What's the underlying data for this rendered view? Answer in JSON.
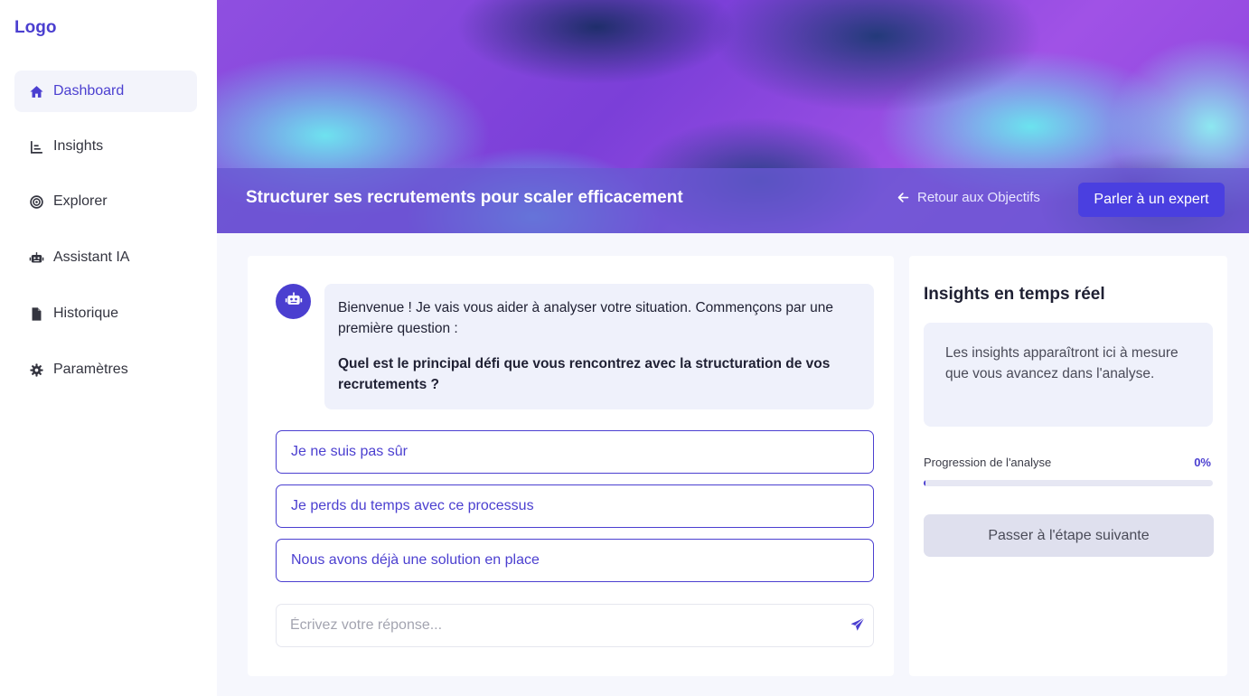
{
  "sidebar": {
    "logo": "Logo",
    "items": [
      {
        "label": "Dashboard",
        "icon": "home-icon",
        "active": true
      },
      {
        "label": "Insights",
        "icon": "chart-icon"
      },
      {
        "label": "Explorer",
        "icon": "target-icon"
      },
      {
        "label": "Assistant IA",
        "icon": "robot-icon"
      },
      {
        "label": "Historique",
        "icon": "file-icon"
      },
      {
        "label": "Paramètres",
        "icon": "gear-icon"
      }
    ]
  },
  "header": {
    "title": "Structurer ses recrutements pour scaler efficacement",
    "back_label": "Retour aux Objectifs",
    "expert_label": "Parler à un expert"
  },
  "chat": {
    "bot_message": "Bienvenue ! Je vais vous aider à analyser votre situation. Commençons par une première question :",
    "bot_question": "Quel est le principal défi que vous rencontrez avec la structuration de vos recrutements ?",
    "options": [
      "Je ne suis pas sûr",
      "Je perds du temps avec ce processus",
      "Nous avons déjà une solution en place"
    ],
    "input_placeholder": "Écrivez votre réponse..."
  },
  "insights": {
    "title": "Insights en temps réel",
    "empty_text": "Les insights apparaîtront ici à mesure que vous avancez dans l'analyse.",
    "progress_label": "Progression de l'analyse",
    "progress_value": "0%",
    "progress_fraction": 0,
    "next_label": "Passer à l'étape suivante"
  },
  "colors": {
    "accent": "#4b3fd0",
    "expert_button": "#4a3fe0",
    "background": "#f6f7fd"
  }
}
